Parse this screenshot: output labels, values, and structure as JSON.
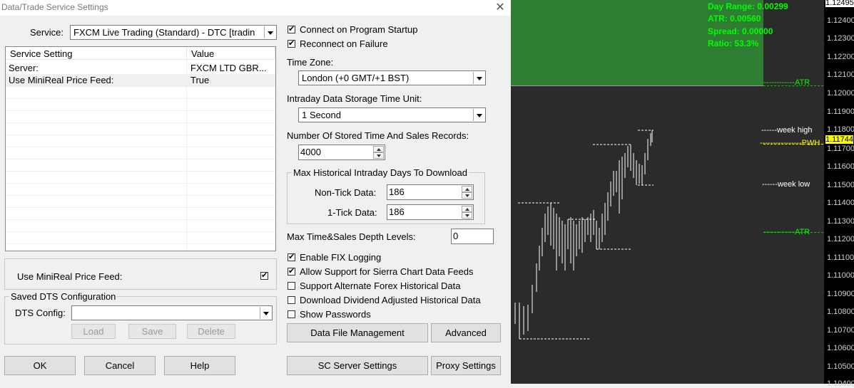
{
  "window": {
    "title": "Data/Trade Service Settings"
  },
  "service": {
    "label": "Service:",
    "value": "FXCM Live Trading (Standard) - DTC    [tradin"
  },
  "table": {
    "headers": [
      "Service Setting",
      "Value"
    ],
    "rows": [
      {
        "setting": "Server:",
        "value": "FXCM LTD GBR..."
      },
      {
        "setting": "Use MiniReal Price Feed:",
        "value": "True"
      }
    ]
  },
  "minireal": {
    "label": "Use MiniReal Price Feed:",
    "checked": true
  },
  "saved_dts": {
    "legend": "Saved DTS Configuration",
    "config_label": "DTS Config:",
    "config_value": "",
    "load_label": "Load",
    "save_label": "Save",
    "delete_label": "Delete"
  },
  "buttons": {
    "ok": "OK",
    "cancel": "Cancel",
    "help": "Help"
  },
  "options": {
    "connect_startup": {
      "label": "Connect on Program Startup",
      "checked": true
    },
    "reconnect_failure": {
      "label": "Reconnect on Failure",
      "checked": true
    }
  },
  "time_zone": {
    "label": "Time Zone:",
    "value": "London (+0 GMT/+1 BST)"
  },
  "intraday_unit": {
    "label": "Intraday Data Storage Time Unit:",
    "value": "1 Second"
  },
  "stored_records": {
    "label": "Number Of Stored Time And Sales Records:",
    "value": "4000"
  },
  "max_days": {
    "legend": "Max Historical Intraday Days To Download",
    "non_tick_label": "Non-Tick Data:",
    "non_tick_value": "186",
    "one_tick_label": "1-Tick Data:",
    "one_tick_value": "186"
  },
  "depth_levels": {
    "label": "Max Time&Sales Depth Levels:",
    "value": "0"
  },
  "checks": {
    "fix_logging": {
      "label": "Enable FIX Logging",
      "checked": true
    },
    "sierra_feeds": {
      "label": "Allow Support for Sierra Chart Data Feeds",
      "checked": true
    },
    "alt_forex": {
      "label": "Support Alternate Forex Historical Data",
      "checked": false
    },
    "dividend": {
      "label": "Download Dividend Adjusted Historical Data",
      "checked": false
    },
    "passwords": {
      "label": "Show Passwords",
      "checked": false
    }
  },
  "bottom_buttons": {
    "data_file": "Data File Management",
    "advanced": "Advanced",
    "sc_server": "SC Server Settings",
    "proxy": "Proxy Settings"
  },
  "chart": {
    "info": [
      "Day Range: 0.00299",
      "ATR: 0.00560",
      "Spread: 0.00000",
      "Ratio: 53.3%"
    ],
    "price_ticks": [
      "1.12495",
      "1.12400",
      "1.12300",
      "1.12200",
      "1.12100",
      "1.12000",
      "1.11900",
      "1.11800",
      "1.11744",
      "1.11700",
      "1.11600",
      "1.11500",
      "1.11400",
      "1.11300",
      "1.11200",
      "1.11100",
      "1.11000",
      "1.10900",
      "1.10800",
      "1.10700",
      "1.10600",
      "1.10500",
      "1.10400"
    ],
    "line_labels": {
      "atr_top": "------------ATR",
      "week_high": "------week high",
      "pwh": "----------------PWH",
      "week_low": "------week low",
      "atr_bottom": "------------ATR"
    },
    "colors": {
      "zone": "#2e7d32",
      "info": "#00ff00",
      "pwh": "#ffff00",
      "atr": "#00ff00",
      "bars": "#ffffff",
      "last_price_bg": "#ffff00"
    }
  }
}
